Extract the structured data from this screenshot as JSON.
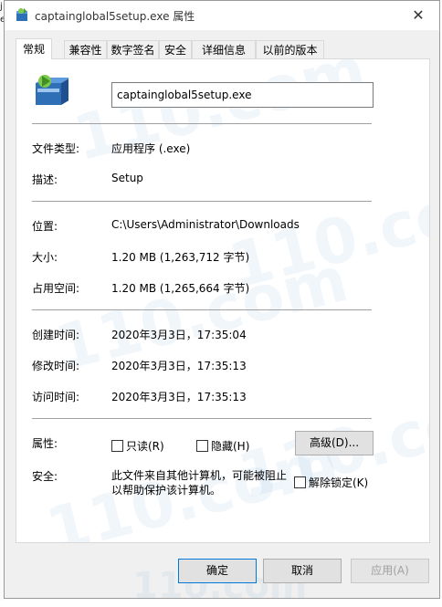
{
  "window": {
    "title": "captainglobal5setup.exe 属性",
    "close_glyph": "✕"
  },
  "tabs": [
    {
      "label": "常规"
    },
    {
      "label": "兼容性"
    },
    {
      "label": "数字签名"
    },
    {
      "label": "安全"
    },
    {
      "label": "详细信息"
    },
    {
      "label": "以前的版本"
    }
  ],
  "general": {
    "file_name": "captainglobal5setup.exe",
    "file_type_label": "文件类型:",
    "file_type_value": "应用程序 (.exe)",
    "description_label": "描述:",
    "description_value": "Setup",
    "location_label": "位置:",
    "location_value": "C:\\Users\\Administrator\\Downloads",
    "size_label": "大小:",
    "size_value": "1.20 MB (1,263,712 字节)",
    "size_on_disk_label": "占用空间:",
    "size_on_disk_value": "1.20 MB (1,265,664 字节)",
    "created_label": "创建时间:",
    "created_value": "2020年3月3日，17:35:04",
    "modified_label": "修改时间:",
    "modified_value": "2020年3月3日，17:35:13",
    "accessed_label": "访问时间:",
    "accessed_value": "2020年3月3日，17:35:13",
    "attributes_label": "属性:",
    "readonly_label": "只读(R)",
    "hidden_label": "隐藏(H)",
    "advanced_button": "高级(D)...",
    "security_label": "安全:",
    "security_text": "此文件来自其他计算机，可能被阻止以帮助保护该计算机。",
    "unblock_label": "解除锁定(K)"
  },
  "buttons": {
    "ok": "确定",
    "cancel": "取消",
    "apply": "应用(A)"
  },
  "watermark": {
    "text": "110.com"
  },
  "icons": {
    "title_icon": "installer-package-icon",
    "file_icon": "installer-package-icon",
    "close": "close-icon"
  },
  "colors": {
    "accent": "#0078d7",
    "panel_bg": "#ffffff",
    "window_bg": "#f0f0f0"
  }
}
